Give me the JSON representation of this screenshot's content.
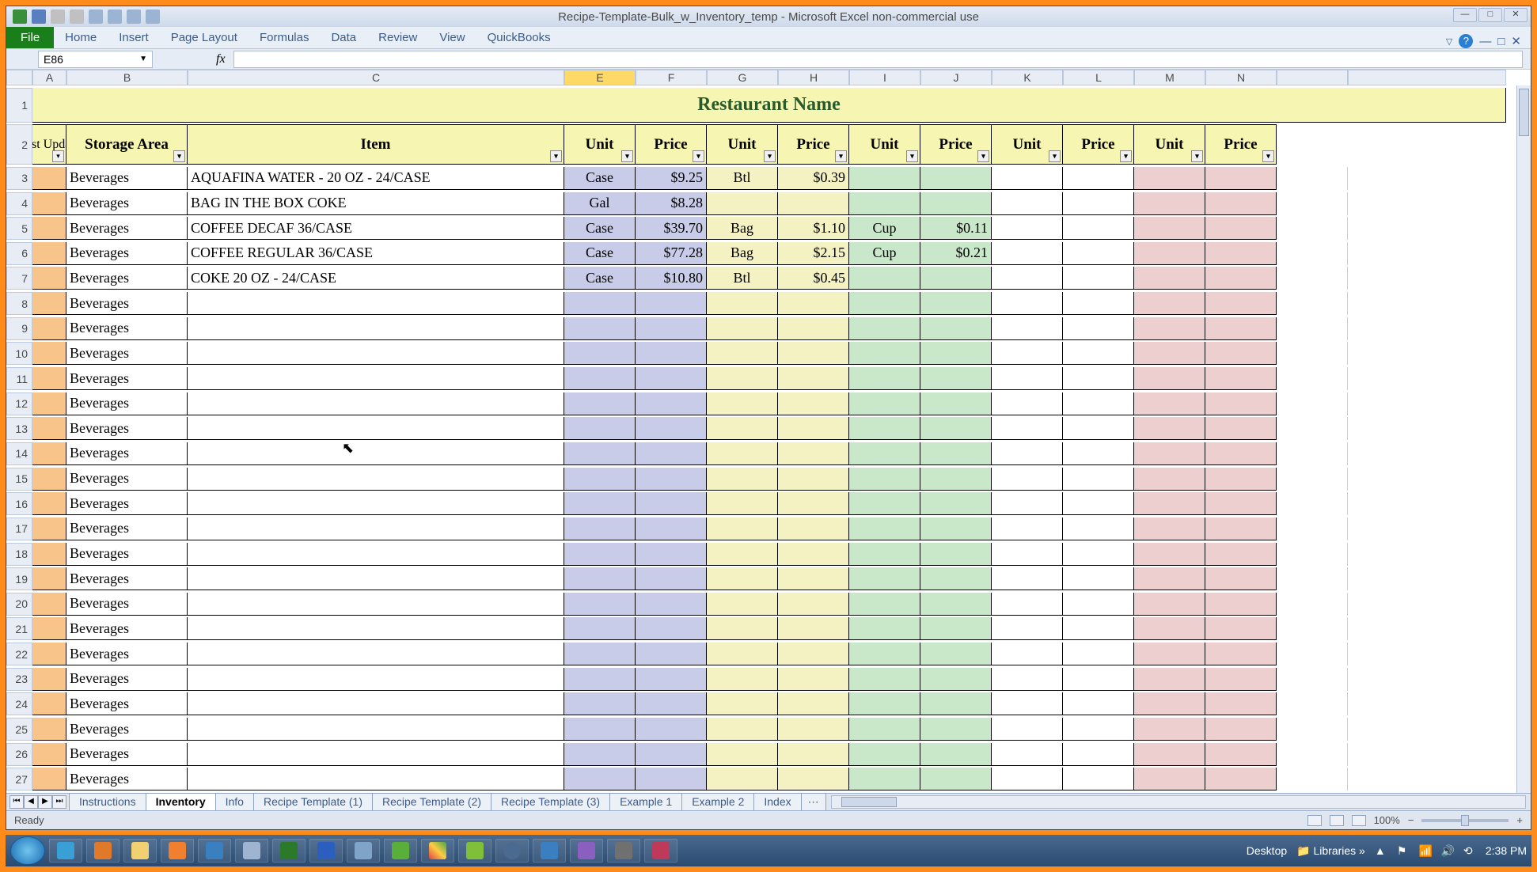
{
  "window": {
    "title": "Recipe-Template-Bulk_w_Inventory_temp  -  Microsoft Excel non-commercial use"
  },
  "ribbon": {
    "tabs": [
      "File",
      "Home",
      "Insert",
      "Page Layout",
      "Formulas",
      "Data",
      "Review",
      "View",
      "QuickBooks"
    ]
  },
  "namebox": {
    "value": "E86"
  },
  "columns": [
    "A",
    "B",
    "C",
    "E",
    "F",
    "G",
    "H",
    "I",
    "J",
    "K",
    "L",
    "M",
    "N"
  ],
  "sheet": {
    "title": "Restaurant Name",
    "headers": {
      "last_update": "Last Update",
      "storage_area": "Storage Area",
      "item": "Item",
      "unit": "Unit",
      "price": "Price"
    }
  },
  "rows": [
    {
      "n": "3",
      "area": "Beverages",
      "item": "AQUAFINA WATER - 20 OZ - 24/CASE",
      "u1": "Case",
      "p1": "$9.25",
      "u2": "Btl",
      "p2": "$0.39",
      "u3": "",
      "p3": ""
    },
    {
      "n": "4",
      "area": "Beverages",
      "item": "BAG IN THE BOX COKE",
      "u1": "Gal",
      "p1": "$8.28",
      "u2": "",
      "p2": "",
      "u3": "",
      "p3": ""
    },
    {
      "n": "5",
      "area": "Beverages",
      "item": "COFFEE DECAF 36/CASE",
      "u1": "Case",
      "p1": "$39.70",
      "u2": "Bag",
      "p2": "$1.10",
      "u3": "Cup",
      "p3": "$0.11"
    },
    {
      "n": "6",
      "area": "Beverages",
      "item": "COFFEE REGULAR 36/CASE",
      "u1": "Case",
      "p1": "$77.28",
      "u2": "Bag",
      "p2": "$2.15",
      "u3": "Cup",
      "p3": "$0.21"
    },
    {
      "n": "7",
      "area": "Beverages",
      "item": "COKE 20 OZ - 24/CASE",
      "u1": "Case",
      "p1": "$10.80",
      "u2": "Btl",
      "p2": "$0.45",
      "u3": "",
      "p3": ""
    },
    {
      "n": "8",
      "area": "Beverages",
      "item": "",
      "u1": "",
      "p1": "",
      "u2": "",
      "p2": "",
      "u3": "",
      "p3": ""
    },
    {
      "n": "9",
      "area": "Beverages",
      "item": "",
      "u1": "",
      "p1": "",
      "u2": "",
      "p2": "",
      "u3": "",
      "p3": ""
    },
    {
      "n": "10",
      "area": "Beverages",
      "item": "",
      "u1": "",
      "p1": "",
      "u2": "",
      "p2": "",
      "u3": "",
      "p3": ""
    },
    {
      "n": "11",
      "area": "Beverages",
      "item": "",
      "u1": "",
      "p1": "",
      "u2": "",
      "p2": "",
      "u3": "",
      "p3": ""
    },
    {
      "n": "12",
      "area": "Beverages",
      "item": "",
      "u1": "",
      "p1": "",
      "u2": "",
      "p2": "",
      "u3": "",
      "p3": ""
    },
    {
      "n": "13",
      "area": "Beverages",
      "item": "",
      "u1": "",
      "p1": "",
      "u2": "",
      "p2": "",
      "u3": "",
      "p3": ""
    },
    {
      "n": "14",
      "area": "Beverages",
      "item": "",
      "u1": "",
      "p1": "",
      "u2": "",
      "p2": "",
      "u3": "",
      "p3": ""
    },
    {
      "n": "15",
      "area": "Beverages",
      "item": "",
      "u1": "",
      "p1": "",
      "u2": "",
      "p2": "",
      "u3": "",
      "p3": ""
    },
    {
      "n": "16",
      "area": "Beverages",
      "item": "",
      "u1": "",
      "p1": "",
      "u2": "",
      "p2": "",
      "u3": "",
      "p3": ""
    },
    {
      "n": "17",
      "area": "Beverages",
      "item": "",
      "u1": "",
      "p1": "",
      "u2": "",
      "p2": "",
      "u3": "",
      "p3": ""
    },
    {
      "n": "18",
      "area": "Beverages",
      "item": "",
      "u1": "",
      "p1": "",
      "u2": "",
      "p2": "",
      "u3": "",
      "p3": ""
    },
    {
      "n": "19",
      "area": "Beverages",
      "item": "",
      "u1": "",
      "p1": "",
      "u2": "",
      "p2": "",
      "u3": "",
      "p3": ""
    },
    {
      "n": "20",
      "area": "Beverages",
      "item": "",
      "u1": "",
      "p1": "",
      "u2": "",
      "p2": "",
      "u3": "",
      "p3": ""
    },
    {
      "n": "21",
      "area": "Beverages",
      "item": "",
      "u1": "",
      "p1": "",
      "u2": "",
      "p2": "",
      "u3": "",
      "p3": ""
    },
    {
      "n": "22",
      "area": "Beverages",
      "item": "",
      "u1": "",
      "p1": "",
      "u2": "",
      "p2": "",
      "u3": "",
      "p3": ""
    },
    {
      "n": "23",
      "area": "Beverages",
      "item": "",
      "u1": "",
      "p1": "",
      "u2": "",
      "p2": "",
      "u3": "",
      "p3": ""
    },
    {
      "n": "24",
      "area": "Beverages",
      "item": "",
      "u1": "",
      "p1": "",
      "u2": "",
      "p2": "",
      "u3": "",
      "p3": ""
    },
    {
      "n": "25",
      "area": "Beverages",
      "item": "",
      "u1": "",
      "p1": "",
      "u2": "",
      "p2": "",
      "u3": "",
      "p3": ""
    },
    {
      "n": "26",
      "area": "Beverages",
      "item": "",
      "u1": "",
      "p1": "",
      "u2": "",
      "p2": "",
      "u3": "",
      "p3": ""
    },
    {
      "n": "27",
      "area": "Beverages",
      "item": "",
      "u1": "",
      "p1": "",
      "u2": "",
      "p2": "",
      "u3": "",
      "p3": ""
    }
  ],
  "sheet_tabs": [
    "Instructions",
    "Inventory",
    "Info",
    "Recipe Template (1)",
    "Recipe Template (2)",
    "Recipe Template (3)",
    "Example 1",
    "Example 2",
    "Index"
  ],
  "active_sheet_tab": "Inventory",
  "status": {
    "ready": "Ready",
    "zoom": "100%"
  },
  "taskbar": {
    "desktop_label": "Desktop",
    "libraries_label": "Libraries",
    "time": "2:38 PM"
  }
}
